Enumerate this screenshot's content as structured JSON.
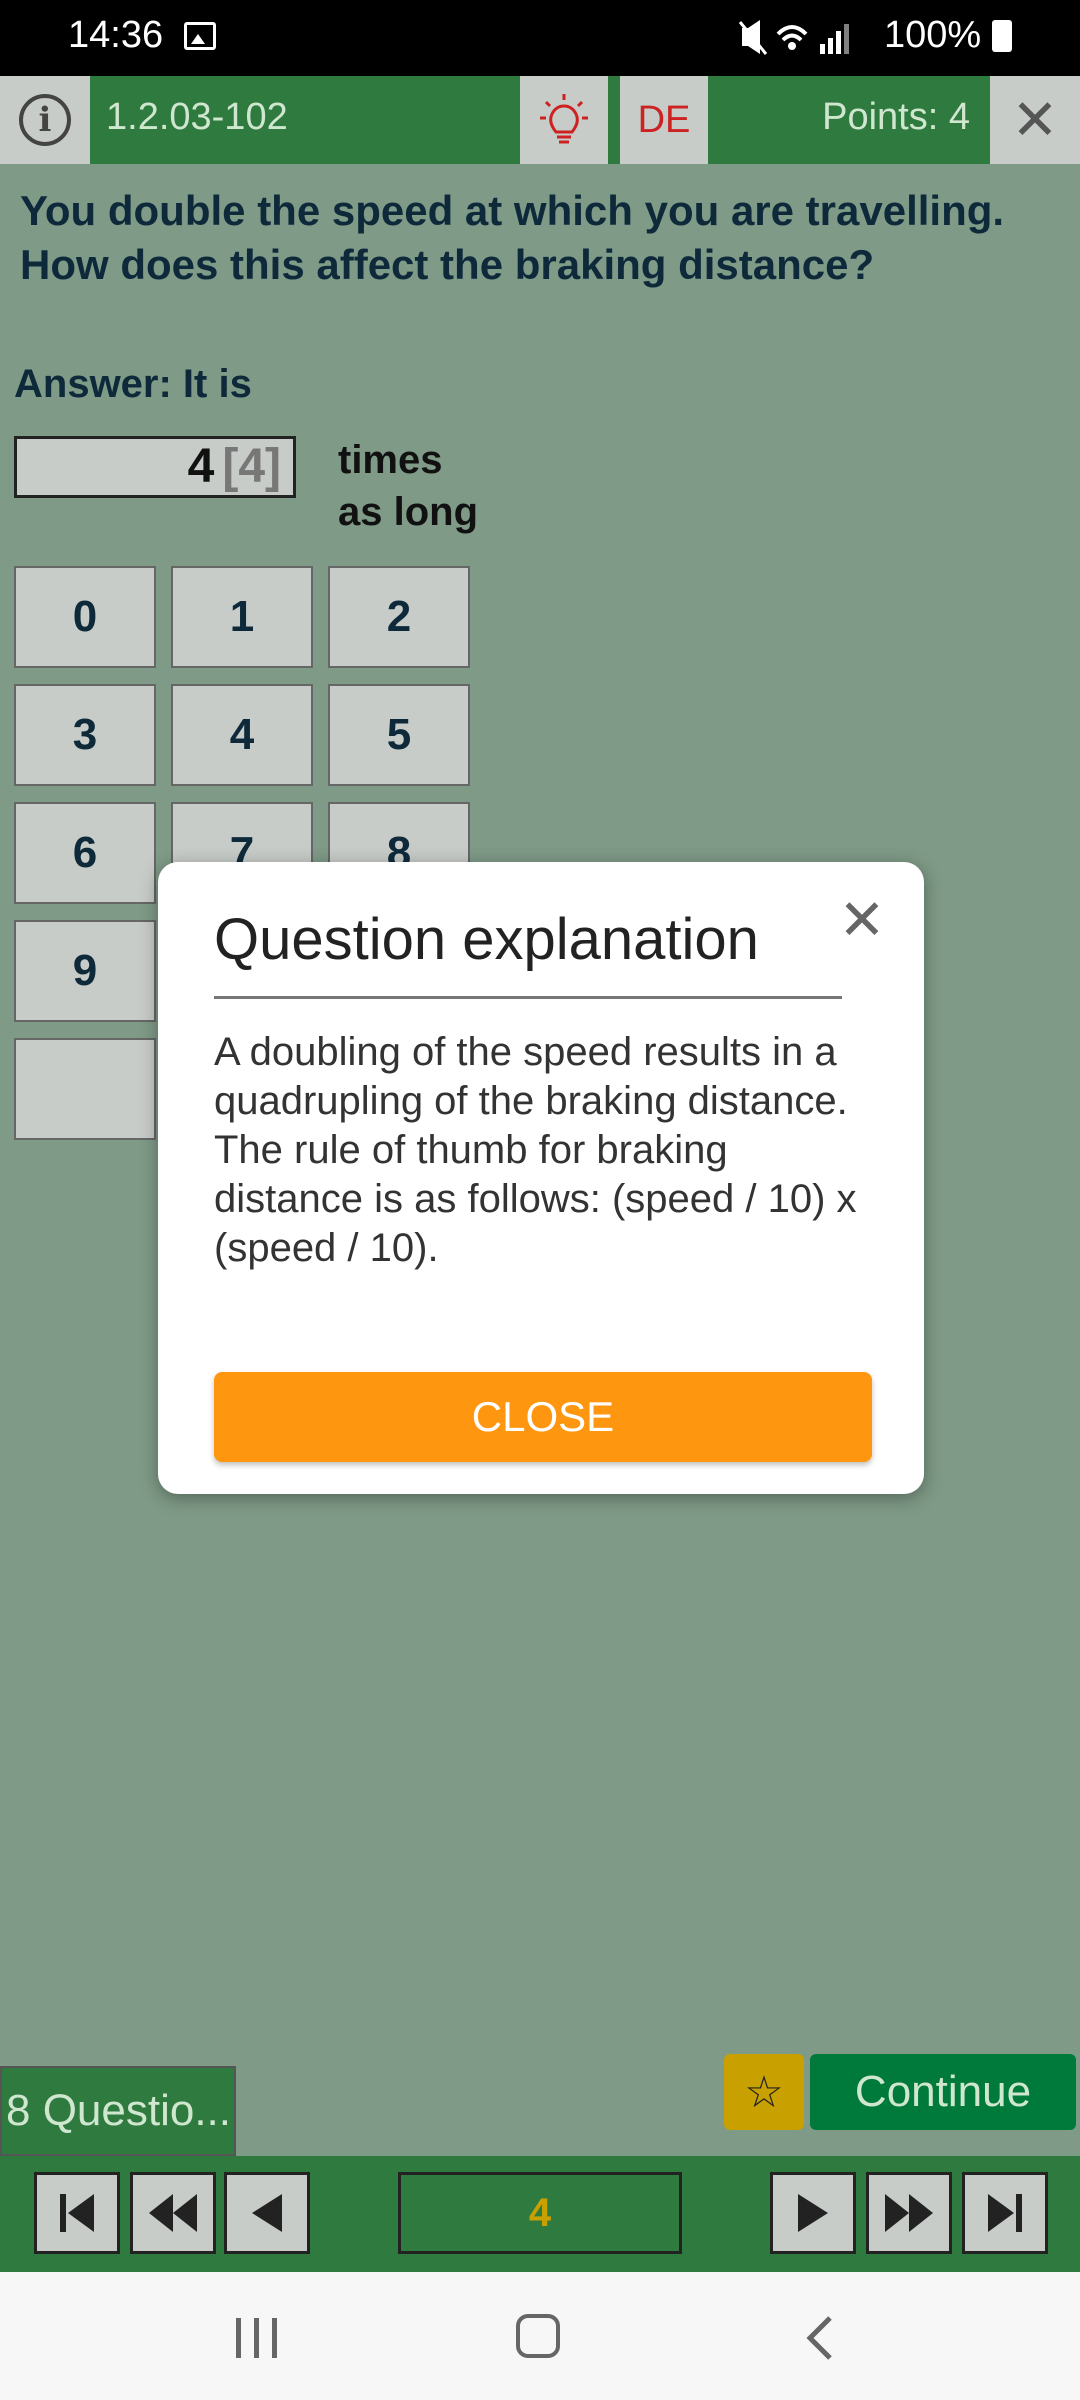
{
  "status_bar": {
    "time": "14:36",
    "battery": "100%"
  },
  "top_bar": {
    "question_id": "1.2.03-102",
    "language": "DE",
    "points": "Points: 4"
  },
  "question": {
    "text": "You double the speed at which you are travelling. How does this affect the braking distance?"
  },
  "answer": {
    "label": "Answer: It is",
    "value": "4",
    "correct_value": "[4]",
    "unit_line1": "times",
    "unit_line2": "as long"
  },
  "keypad": [
    "0",
    "1",
    "2",
    "3",
    "4",
    "5",
    "6",
    "7",
    "8",
    "9"
  ],
  "dialog": {
    "title": "Question explanation",
    "body": "A doubling of the speed results in a quadrupling of the braking distance. The rule of thumb for braking distance is as follows: (speed / 10) x (speed / 10).",
    "close_label": "CLOSE"
  },
  "bottom": {
    "question_count": "8 Questio...",
    "continue_label": "Continue",
    "current_page": "4"
  },
  "colors": {
    "background": "#7f9a87",
    "bar_green": "#2f7a3f",
    "accent_orange": "#ff9610",
    "continue_green": "#007a3a",
    "star_gold": "#c8a000"
  }
}
